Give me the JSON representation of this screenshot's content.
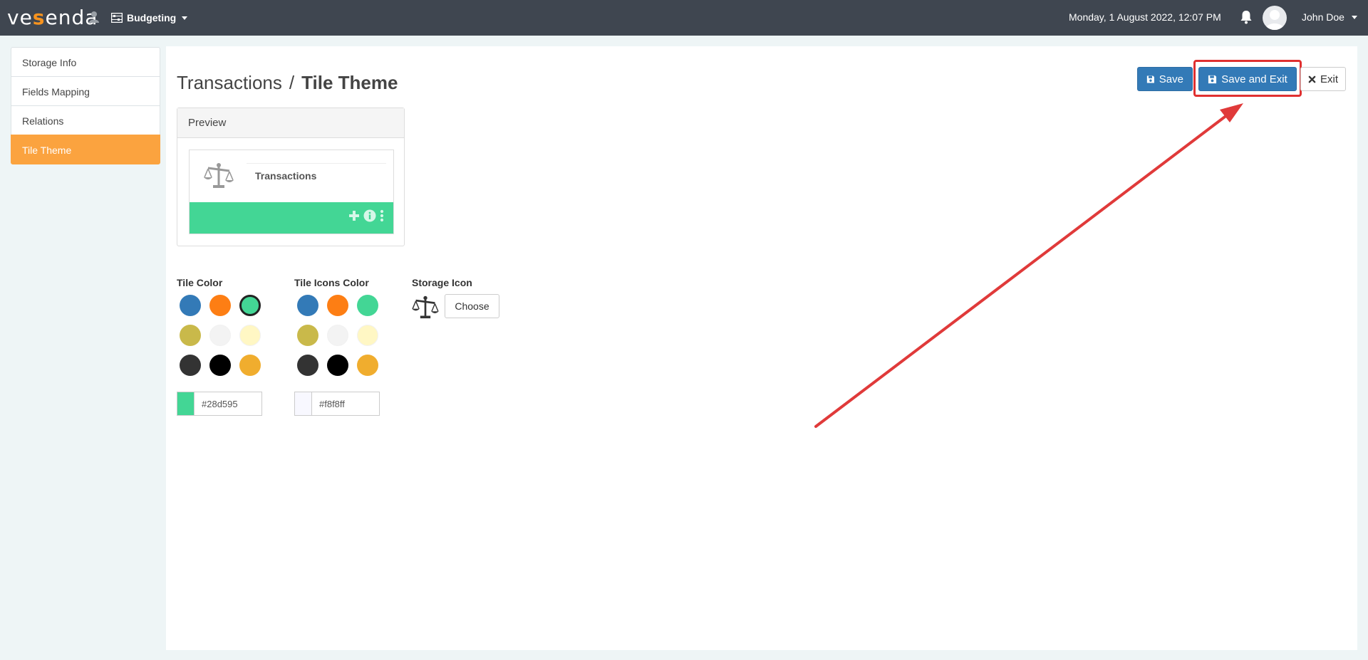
{
  "header": {
    "logo_prefix": "ve",
    "logo_accent": "s",
    "logo_suffix": "enda",
    "app_name": "Budgeting",
    "datetime": "Monday, 1 August 2022, 12:07 PM",
    "user_name": "John Doe"
  },
  "sidebar": {
    "items": [
      {
        "label": "Storage Info",
        "active": false
      },
      {
        "label": "Fields Mapping",
        "active": false
      },
      {
        "label": "Relations",
        "active": false
      },
      {
        "label": "Tile Theme",
        "active": true
      }
    ]
  },
  "page": {
    "breadcrumb_parent": "Transactions",
    "separator": "/",
    "title": "Tile Theme"
  },
  "actions": {
    "save_label": "Save",
    "save_exit_label": "Save and Exit",
    "exit_label": "Exit"
  },
  "preview": {
    "header": "Preview",
    "tile_title": "Transactions"
  },
  "tile_color": {
    "label": "Tile Color",
    "value": "#28d595",
    "swatches": [
      "#337ab7",
      "#fd7e14",
      "#43d695",
      "#c9b94a",
      "#f3f3f3",
      "#fff7c4",
      "#333333",
      "#000000",
      "#f0ad2e"
    ],
    "selected_index": 2
  },
  "tile_icons_color": {
    "label": "Tile Icons Color",
    "value": "#f8f8ff",
    "swatches": [
      "#337ab7",
      "#fd7e14",
      "#43d695",
      "#c9b94a",
      "#f3f3f3",
      "#fff7c4",
      "#333333",
      "#000000",
      "#f0ad2e"
    ]
  },
  "storage_icon": {
    "label": "Storage Icon",
    "choose_label": "Choose",
    "icon": "balance-scale-icon"
  },
  "colors": {
    "topbar": "#3f4650",
    "accent_orange": "#fba33f",
    "primary": "#337ab7",
    "tile_green": "#43d695",
    "annotation_red": "#e03030"
  }
}
